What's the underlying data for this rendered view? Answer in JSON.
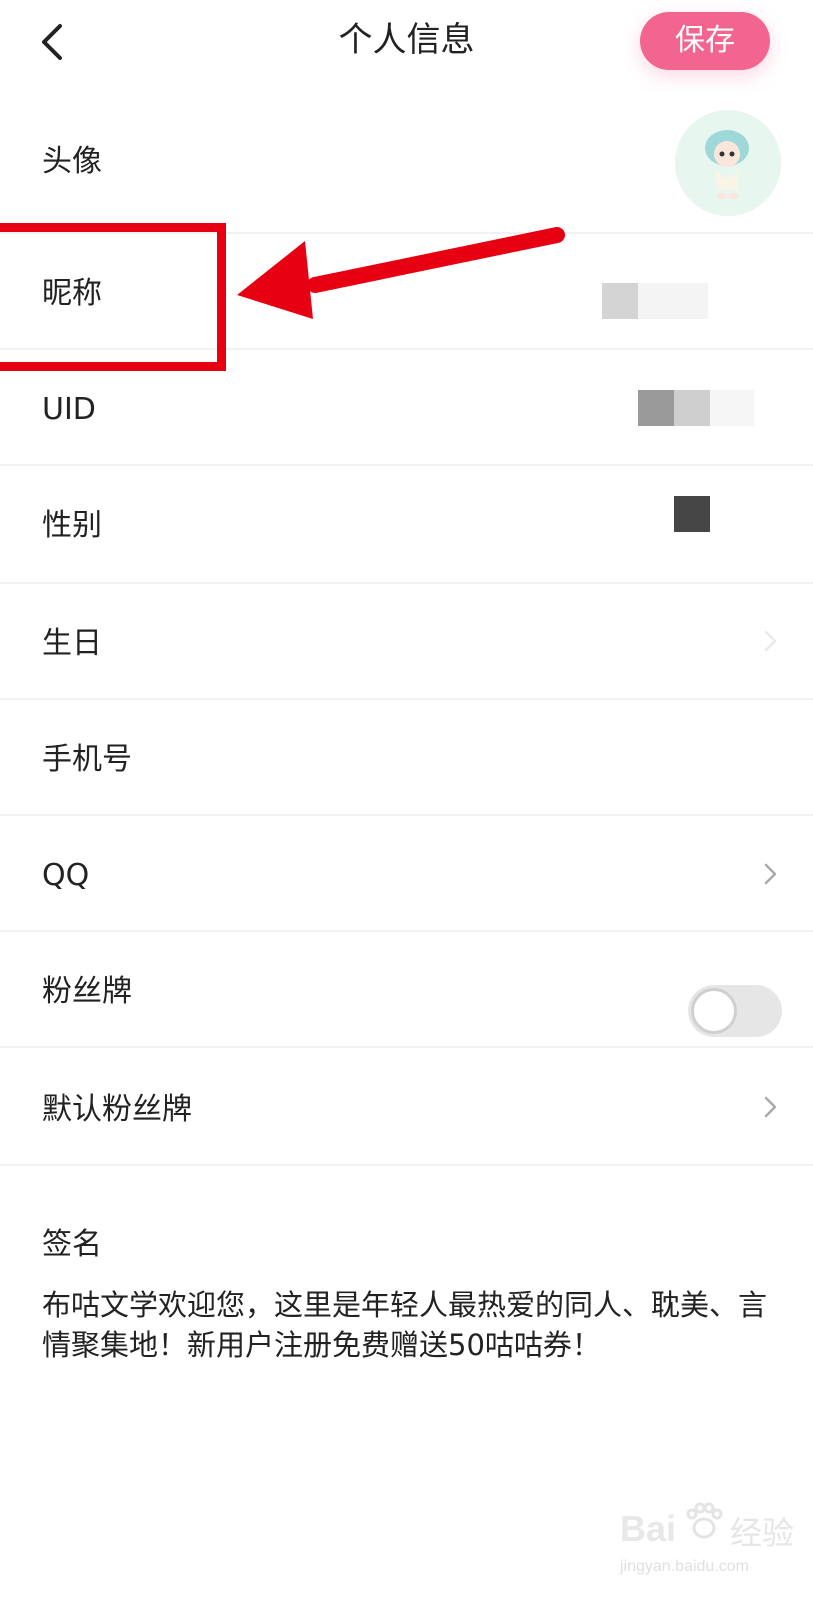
{
  "header": {
    "title": "个人信息",
    "save_label": "保存"
  },
  "rows": [
    {
      "label": "头像"
    },
    {
      "label": "昵称"
    },
    {
      "label": "UID"
    },
    {
      "label": "性别"
    },
    {
      "label": "生日"
    },
    {
      "label": "手机号"
    },
    {
      "label": "QQ"
    },
    {
      "label": "粉丝牌"
    },
    {
      "label": "默认粉丝牌"
    }
  ],
  "fan_badge_toggle": {
    "on": false
  },
  "signature": {
    "label": "签名",
    "text": "布咕文学欢迎您，这里是年轻人最热爱的同人、耽美、言情聚集地！新用户注册免费赠送50咕咕券！"
  },
  "watermark": {
    "logo": "Bai",
    "cn": "经验",
    "url": "jingyan.baidu.com"
  },
  "colors": {
    "accent": "#f2658f",
    "highlight": "#e60012",
    "divider": "#f1f1f1"
  }
}
